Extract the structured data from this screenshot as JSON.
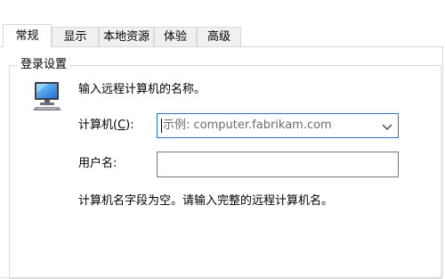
{
  "tabs": [
    {
      "label": "常规",
      "active": true
    },
    {
      "label": "显示",
      "active": false
    },
    {
      "label": "本地资源",
      "active": false
    },
    {
      "label": "体验",
      "active": false
    },
    {
      "label": "高级",
      "active": false
    }
  ],
  "login": {
    "group_title": "登录设置",
    "instruction": "输入远程计算机的名称。",
    "computer_label_main": "计算机(",
    "computer_label_key": "C",
    "computer_label_end": "):",
    "computer_placeholder": "示例: computer.fabrikam.com",
    "computer_value": "",
    "username_label": "用户名:",
    "username_value": "",
    "empty_field_note": "计算机名字段为空。请输入完整的远程计算机名。"
  },
  "icons": {
    "computer": "remote-computer-icon",
    "dropdown": "chevron-down-icon"
  },
  "colors": {
    "focus_border": "#2e6fd1",
    "placeholder_text": "#6d6d6d",
    "tab_inactive_bg": "#f0f0f0"
  }
}
